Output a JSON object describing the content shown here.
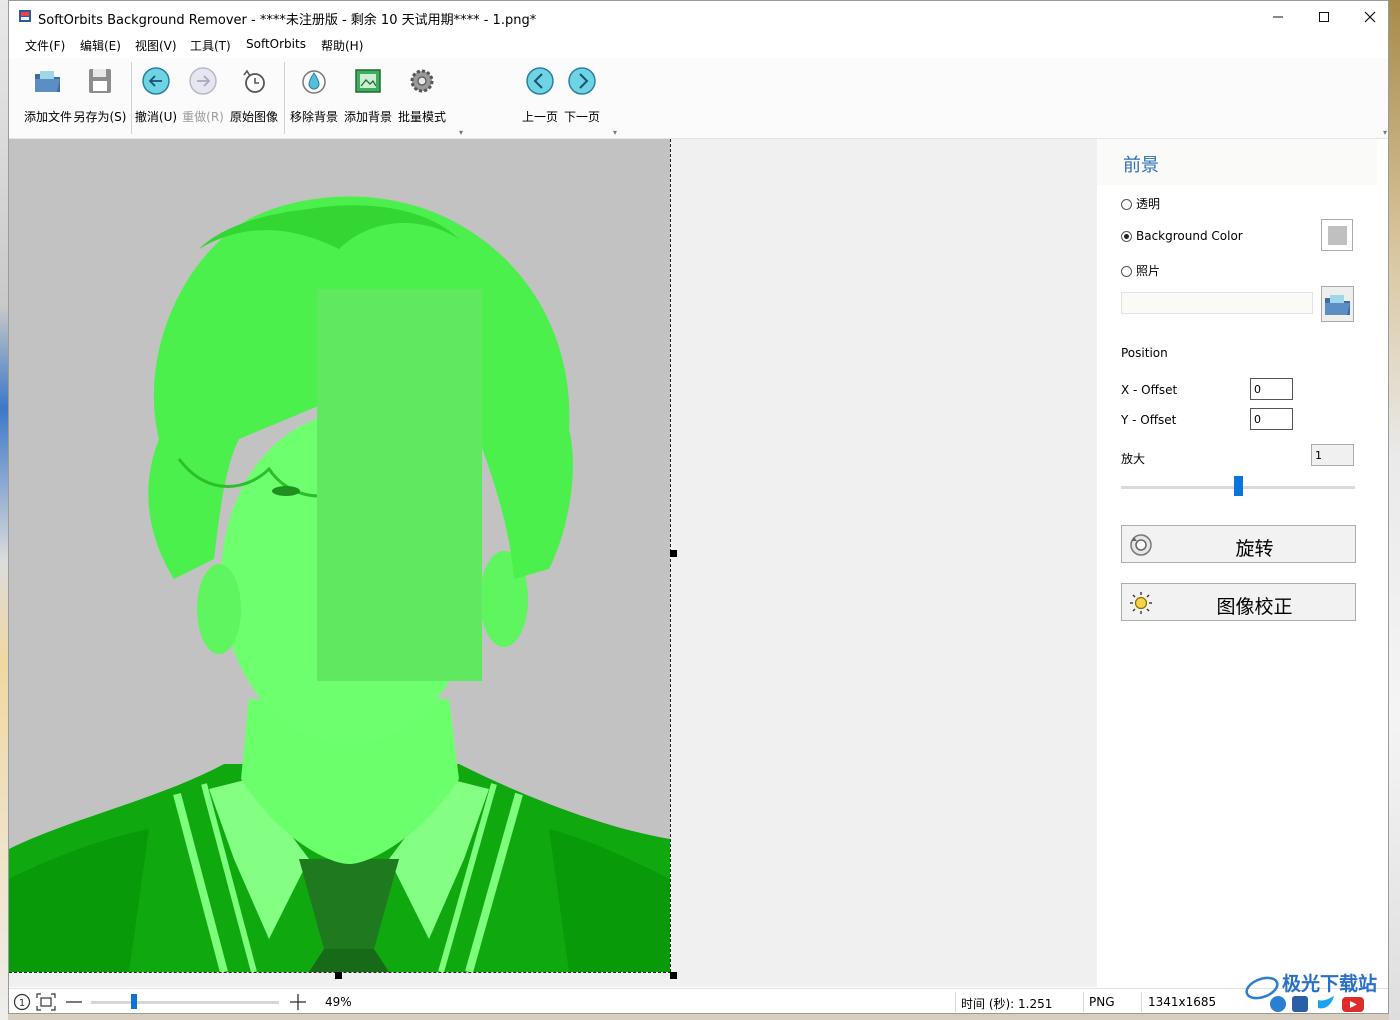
{
  "window": {
    "title": "SoftOrbits Background Remover - ****未注册版 - 剩余 10 天试用期**** - 1.png*",
    "min_icon": "minimize-icon",
    "max_icon": "maximize-icon",
    "close_icon": "close-icon"
  },
  "menu": [
    "文件(F)",
    "编辑(E)",
    "视图(V)",
    "工具(T)",
    "SoftOrbits",
    "帮助(H)"
  ],
  "toolbar": {
    "add_file": "添加文件",
    "save_as": "另存为(S)",
    "undo": "撤消(U)",
    "redo": "重做(R)",
    "original": "原始图像",
    "remove_bg": "移除背景",
    "add_bg": "添加背景",
    "batch": "批量模式",
    "prev": "上一页",
    "next": "下一页"
  },
  "panel": {
    "title": "前景",
    "opt_transparent": "透明",
    "opt_bgcolor": "Background Color",
    "opt_photo": "照片",
    "selected_option": "Background Color",
    "bg_color": "#c0c0c0",
    "photo_path": "",
    "position_label": "Position",
    "x_label": "X - Offset",
    "x_value": "0",
    "y_label": "Y - Offset",
    "y_value": "0",
    "zoom_label": "放大",
    "zoom_value": "1",
    "zoom_slider_fraction": 0.5,
    "rotate_btn": "旋转",
    "correct_btn": "图像校正"
  },
  "status": {
    "zoom_percent": "49%",
    "zoom_slider_fraction": 0.22,
    "time": "时间 (秒): 1.251",
    "format": "PNG",
    "dimensions": "1341x1685"
  },
  "colors": {
    "accent_blue": "#2d6fb8",
    "slider_blue": "#0a74da",
    "mask_green": "#5cff5c",
    "canvas_bg": "#c2c2c2"
  },
  "watermark": "极光下载站"
}
